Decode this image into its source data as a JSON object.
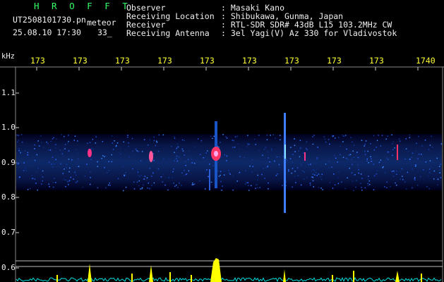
{
  "header": {
    "app_title": "H R O F F T",
    "file_name": "UT2508101730.pn",
    "file_tag": "meteor",
    "datetime": "25.08.10 17:30",
    "frame_no": "33_"
  },
  "station_info": [
    {
      "label": "Observer",
      "value": ": Masaki Kano"
    },
    {
      "label": "Receiving Location",
      "value": ": Shibukawa, Gunma, Japan"
    },
    {
      "label": "Receiver",
      "value": ": RTL-SDR SDR# 43dB L15 103.2MHz CW"
    },
    {
      "label": "Receiving Antenna",
      "value": ": 3el Yagi(V) Az 330 for Vladivostok"
    }
  ],
  "axes": {
    "unit_label": "kHz",
    "x_ticks": [
      "173",
      "173",
      "173",
      "173",
      "173",
      "173",
      "173",
      "173",
      "173",
      "1740"
    ],
    "y_ticks": [
      "1.1",
      "1.0",
      "0.9",
      "0.8",
      "0.7",
      "0.6"
    ]
  },
  "colors": {
    "text": "#f0f0f0",
    "title": "#33ff66",
    "ticks": "#ffff33",
    "signal_hot": "#ff3366",
    "spectrum": "#ffff00",
    "noise": "#00ffff"
  }
}
